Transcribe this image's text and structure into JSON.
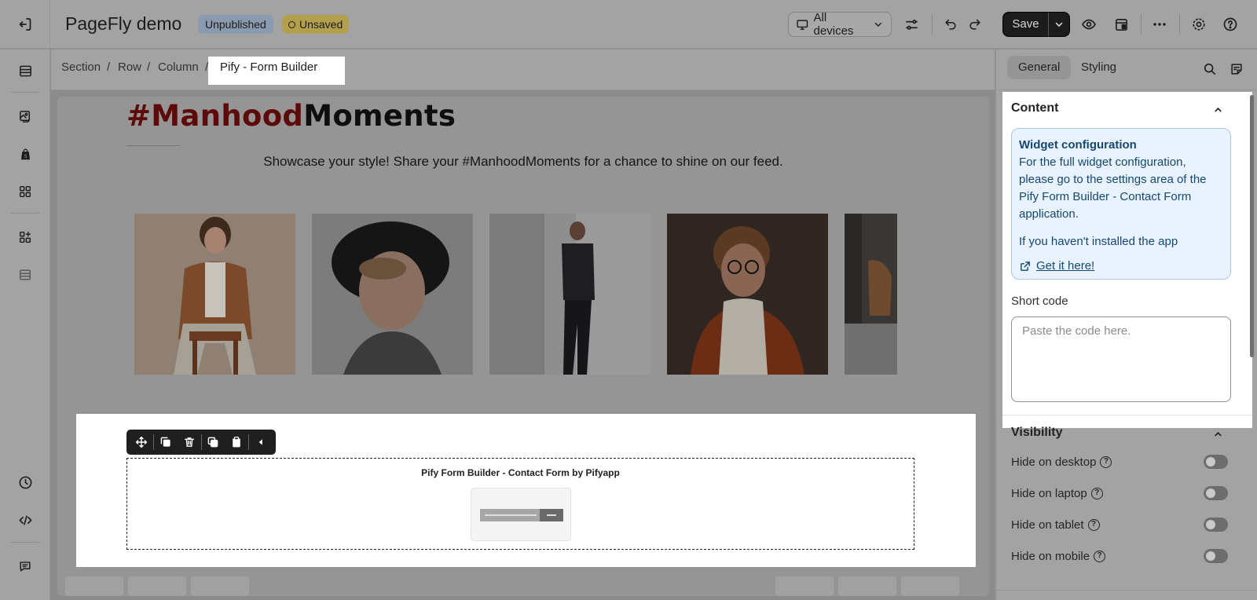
{
  "topbar": {
    "title": "PageFly demo",
    "badge_status": "Unpublished",
    "badge_save": "Unsaved",
    "device_label": "All devices",
    "save_label": "Save"
  },
  "breadcrumb": {
    "items": [
      "Section",
      "Row",
      "Column"
    ],
    "separator": "/",
    "active": "Pify - Form Builder"
  },
  "canvas": {
    "headline_hash": "#Manhood",
    "headline_rest": "Moments",
    "subline": "Showcase your style! Share your #ManhoodMoments for a chance to shine on our feed.",
    "form_title": "Pify Form Builder - Contact Form by Pifyapp"
  },
  "panel": {
    "tabs": [
      "General",
      "Styling"
    ],
    "content_title": "Content",
    "info_title": "Widget configuration",
    "info_text": "For the full widget configuration, please go to the settings area of the Pify Form Builder - Contact Form application.",
    "info_install": "If you haven't installed the app",
    "info_link": "Get it here!",
    "short_code_label": "Short code",
    "short_code_placeholder": "Paste the code here.",
    "visibility_title": "Visibility",
    "visibility": [
      {
        "label": "Hide on desktop",
        "on": false
      },
      {
        "label": "Hide on laptop",
        "on": false
      },
      {
        "label": "Hide on tablet",
        "on": false
      },
      {
        "label": "Hide on mobile",
        "on": false
      }
    ]
  }
}
